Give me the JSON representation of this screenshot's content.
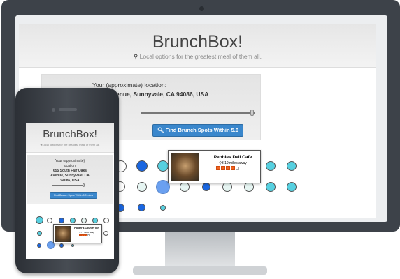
{
  "app": {
    "title": "BrunchBox!",
    "tagline": "Local options for the greatest meal of them all."
  },
  "location": {
    "label": "Your (approximate) location:",
    "address": "655 South Fair Oaks Avenue, Sunnyvale, CA 94086, USA",
    "label_mobile_1": "Your (approximate)",
    "label_mobile_2": "location:",
    "address_mobile_1": "655 South Fair Oaks",
    "address_mobile_2": "Avenue, Sunnyvale, CA",
    "address_mobile_3": "94086, USA"
  },
  "distance_slider": {
    "value_miles": 5.0,
    "max_miles": 5.0
  },
  "search_button": {
    "label": "Find Brunch Spots Within 5.0 miles"
  },
  "desktop_result": {
    "name": "Pebbles Deli Cafe",
    "distance": "3.19 miles away",
    "rating": 4,
    "max_rating": 5
  },
  "mobile_result": {
    "name": "Holder's Country Inn",
    "distance": "3.?? miles away",
    "rating": 4,
    "max_rating": 5
  },
  "colors": {
    "blue": "#1a66e0",
    "cyan": "#56d0e0",
    "pale": "#e6f5f2",
    "white": "#ffffff",
    "mid_blue": "#6aa0f0",
    "button": "#3a87cc"
  }
}
